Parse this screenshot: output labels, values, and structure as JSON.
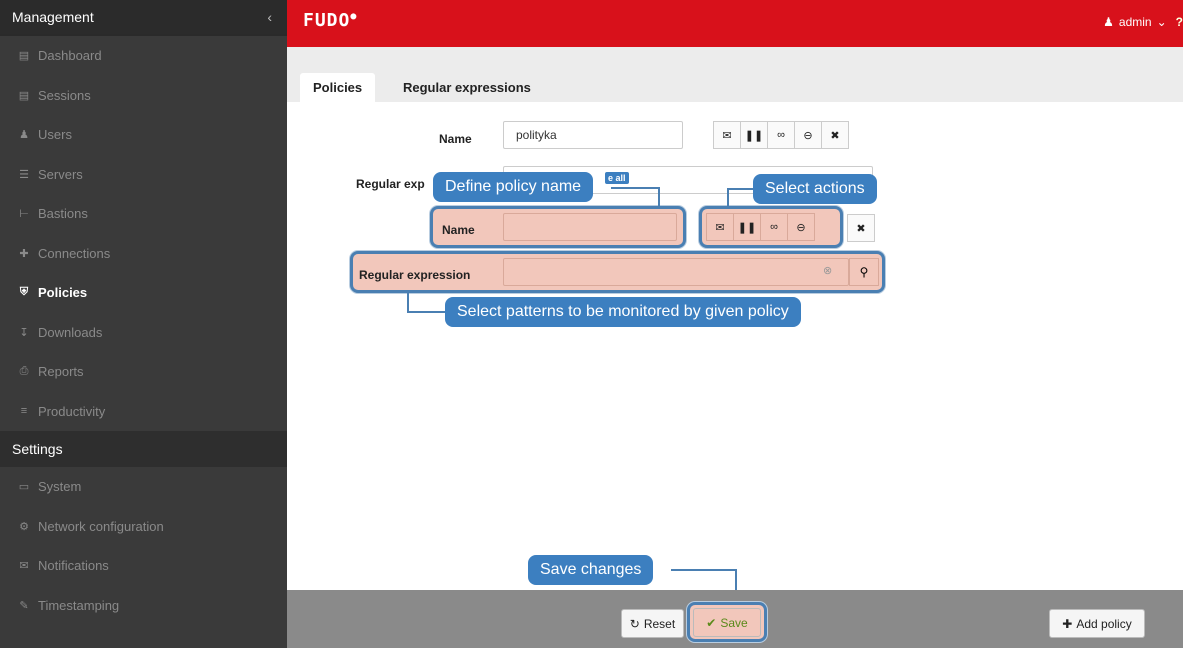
{
  "sidebar": {
    "management_title": "Management",
    "collapse_icon": "chevron-left",
    "items": [
      {
        "label": "Dashboard",
        "icon": "bar-chart"
      },
      {
        "label": "Sessions",
        "icon": "film"
      },
      {
        "label": "Users",
        "icon": "users"
      },
      {
        "label": "Servers",
        "icon": "server"
      },
      {
        "label": "Bastions",
        "icon": "sitemap"
      },
      {
        "label": "Connections",
        "icon": "arrows"
      },
      {
        "label": "Policies",
        "icon": "shield",
        "active": true
      },
      {
        "label": "Downloads",
        "icon": "download"
      },
      {
        "label": "Reports",
        "icon": "printer"
      },
      {
        "label": "Productivity",
        "icon": "list"
      }
    ],
    "settings_title": "Settings",
    "settings_items": [
      {
        "label": "System",
        "icon": "folder"
      },
      {
        "label": "Network configuration",
        "icon": "cogs"
      },
      {
        "label": "Notifications",
        "icon": "envelope"
      },
      {
        "label": "Timestamping",
        "icon": "edit"
      }
    ]
  },
  "topbar": {
    "logo": "FUDO",
    "user": "admin",
    "help": "?"
  },
  "tabs": [
    {
      "label": "Policies",
      "active": true
    },
    {
      "label": "Regular expressions",
      "active": false
    }
  ],
  "form": {
    "name_label": "Name",
    "name_value": "polityka",
    "regexp_label_partial": "Regular exp",
    "regexp_badge_partial": "e all",
    "name_label_2": "Name",
    "regexp_label_2": "Regular expression"
  },
  "tooltips": {
    "define_name": "Define policy name",
    "select_actions": "Select actions",
    "select_patterns": "Select patterns to be monitored by given policy",
    "save_changes": "Save changes"
  },
  "footer": {
    "reset_label": "Reset",
    "save_label": "Save",
    "add_policy_label": "Add policy"
  },
  "colors": {
    "topbar": "#d8111b",
    "sidebar": "#3a3a3a",
    "highlight": "#f2c7bb",
    "tooltip": "#3c7fc0"
  }
}
